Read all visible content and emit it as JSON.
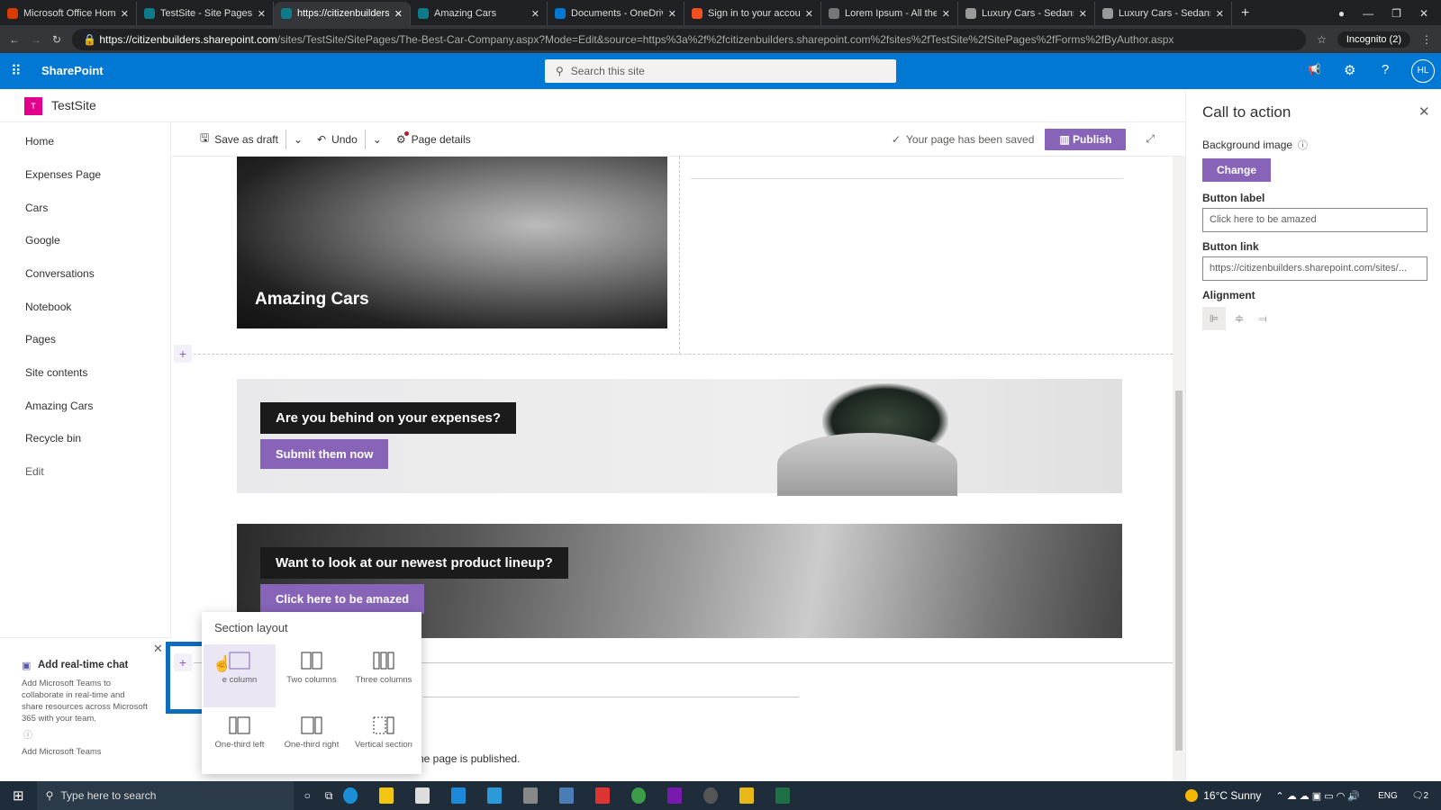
{
  "browser": {
    "tabs": [
      {
        "title": "Microsoft Office Home",
        "color": "#d83b01"
      },
      {
        "title": "TestSite - Site Pages -",
        "color": "#0f7b8a"
      },
      {
        "title": "https://citizenbuilders.",
        "color": "#0f7b8a",
        "active": true
      },
      {
        "title": "Amazing Cars",
        "color": "#0f7b8a"
      },
      {
        "title": "Documents - OneDrive",
        "color": "#0078d4"
      },
      {
        "title": "Sign in to your account",
        "color": "#f25022"
      },
      {
        "title": "Lorem Ipsum - All the",
        "color": "#777"
      },
      {
        "title": "Luxury Cars - Sedans,",
        "color": "#999"
      },
      {
        "title": "Luxury Cars - Sedans,",
        "color": "#999"
      }
    ],
    "url_host": "https://citizenbuilders.sharepoint.com",
    "url_path": "/sites/TestSite/SitePages/The-Best-Car-Company.aspx?Mode=Edit&source=https%3a%2f%2fcitizenbuilders.sharepoint.com%2fsites%2fTestSite%2fSitePages%2fForms%2fByAuthor.aspx",
    "profile": "Incognito (2)"
  },
  "suite": {
    "app": "SharePoint",
    "search_placeholder": "Search this site",
    "avatar": "HL"
  },
  "site": {
    "name": "TestSite",
    "logo_letter": "T",
    "accent": "#e3008c"
  },
  "nav": [
    "Home",
    "Expenses Page",
    "Cars",
    "Google",
    "Conversations",
    "Notebook",
    "Pages",
    "Site contents",
    "Amazing Cars",
    "Recycle bin",
    "Edit"
  ],
  "toolbar": {
    "save": "Save as draft",
    "undo": "Undo",
    "details": "Page details",
    "status": "Your page has been saved",
    "publish": "Publish"
  },
  "content": {
    "hero_title": "Amazing Cars",
    "cta1": {
      "text": "Are you behind on your expenses?",
      "button": "Submit them now"
    },
    "cta2": {
      "text": "Want to look at our newest product lineup?",
      "button": "Click here to be amazed"
    },
    "footer_text": "he page is published."
  },
  "panel": {
    "title": "Call to action",
    "bg_label": "Background image",
    "change": "Change",
    "label_label": "Button label",
    "label_value": "Click here to be amazed",
    "link_label": "Button link",
    "link_value": "https://citizenbuilders.sharepoint.com/sites/...",
    "align_label": "Alignment"
  },
  "teams": {
    "title": "Add real-time chat",
    "body": "Add Microsoft Teams to collaborate in real-time and share resources across Microsoft 365 with your team.",
    "link": "Add Microsoft Teams"
  },
  "section_layout": {
    "title": "Section layout",
    "options": [
      "One column",
      "Two columns",
      "Three columns",
      "One-third left",
      "One-third right",
      "Vertical section"
    ],
    "visible_one": "e column"
  },
  "taskbar": {
    "search": "Type here to search",
    "weather": "16°C  Sunny",
    "lang": "ENG",
    "notif": "2"
  },
  "colors": {
    "purple": "#8764b8",
    "blue": "#0078d4"
  }
}
